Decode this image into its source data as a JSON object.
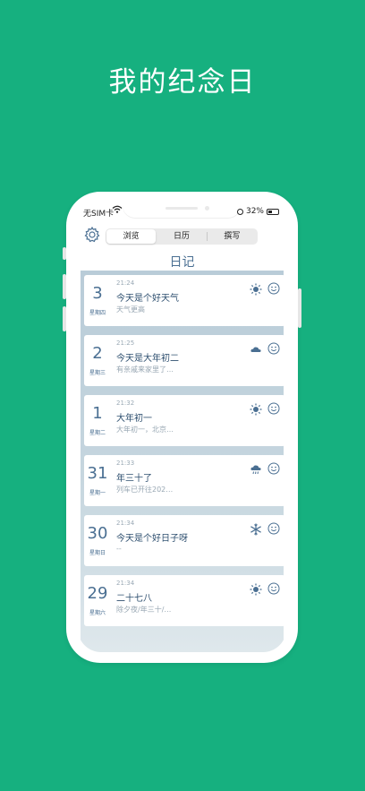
{
  "headline": "我的纪念日",
  "status": {
    "carrier": "无SIM卡",
    "battery": "32%"
  },
  "tabs": [
    {
      "label": "浏览",
      "active": true
    },
    {
      "label": "日历",
      "active": false
    },
    {
      "label": "撰写",
      "active": false
    }
  ],
  "page_title": "日记",
  "entries": [
    {
      "day": "3",
      "weekday": "星期四",
      "time": "21:24",
      "title": "今天是个好天气",
      "preview": "天气更高",
      "weather": "sunny-icon",
      "mood": "smile-icon"
    },
    {
      "day": "2",
      "weekday": "星期三",
      "time": "21:25",
      "title": "今天是大年初二",
      "preview": "有亲戚来家里了…",
      "weather": "cloudy-icon",
      "mood": "smile-icon"
    },
    {
      "day": "1",
      "weekday": "星期二",
      "time": "21:32",
      "title": "大年初一",
      "preview": "大年初一，北京…",
      "weather": "sunny-icon",
      "mood": "smile-icon"
    },
    {
      "day": "31",
      "weekday": "星期一",
      "time": "21:33",
      "title": "年三十了",
      "preview": "列车已开往202…",
      "weather": "rain-icon",
      "mood": "smile-icon"
    },
    {
      "day": "30",
      "weekday": "星期日",
      "time": "21:34",
      "title": "今天是个好日子呀",
      "preview": "--",
      "weather": "snow-icon",
      "mood": "smile-icon"
    },
    {
      "day": "29",
      "weekday": "星期六",
      "time": "21:34",
      "title": "二十七八",
      "preview": "除夕夜/年三十/…",
      "weather": "sunny-icon",
      "mood": "smile-icon"
    }
  ],
  "colors": {
    "background": "#16b07f",
    "accent": "#4a6f92"
  }
}
